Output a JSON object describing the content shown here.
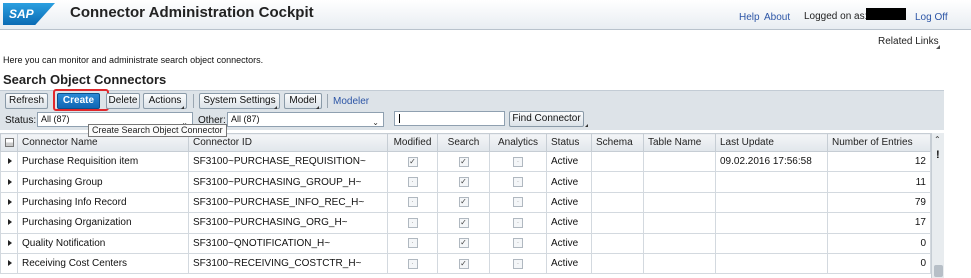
{
  "app": {
    "logo": "SAP",
    "title": "Connector Administration Cockpit"
  },
  "header_links": {
    "help": "Help",
    "about": "About",
    "logged_on": "Logged on as:",
    "log_off": "Log Off"
  },
  "related_links": "Related Links",
  "intro": "Here you can monitor and administrate search object connectors.",
  "section_title": "Search Object Connectors",
  "toolbar": {
    "refresh": "Refresh",
    "create": "Create",
    "delete": "Delete",
    "actions": "Actions",
    "system_settings": "System Settings",
    "model": "Model",
    "modeler": "Modeler"
  },
  "filters": {
    "status_label": "Status:",
    "status_value": "All (87)",
    "other_label": "Other:",
    "other_value": "All (87)",
    "search_value": "",
    "find_button": "Find Connector"
  },
  "tooltip": "Create Search Object Connector",
  "columns": [
    "Connector Name",
    "Connector ID",
    "Modified",
    "Search",
    "Analytics",
    "Status",
    "Schema",
    "Table Name",
    "Last Update",
    "Number of Entries"
  ],
  "rows": [
    {
      "name": "Purchase Requisition item",
      "id": "SF3100~PURCHASE_REQUISITION~",
      "modified": true,
      "search": true,
      "analytics": false,
      "status": "Active",
      "schema": "",
      "table": "",
      "last_update": "09.02.2016 17:56:58",
      "entries": "12"
    },
    {
      "name": "Purchasing Group",
      "id": "SF3100~PURCHASING_GROUP_H~",
      "modified": false,
      "search": true,
      "analytics": false,
      "status": "Active",
      "schema": "",
      "table": "",
      "last_update": "",
      "entries": "11"
    },
    {
      "name": "Purchasing Info Record",
      "id": "SF3100~PURCHASE_INFO_REC_H~",
      "modified": false,
      "search": true,
      "analytics": false,
      "status": "Active",
      "schema": "",
      "table": "",
      "last_update": "",
      "entries": "79"
    },
    {
      "name": "Purchasing Organization",
      "id": "SF3100~PURCHASING_ORG_H~",
      "modified": false,
      "search": true,
      "analytics": false,
      "status": "Active",
      "schema": "",
      "table": "",
      "last_update": "",
      "entries": "17"
    },
    {
      "name": "Quality Notification",
      "id": "SF3100~QNOTIFICATION_H~",
      "modified": false,
      "search": true,
      "analytics": false,
      "status": "Active",
      "schema": "",
      "table": "",
      "last_update": "",
      "entries": "0"
    },
    {
      "name": "Receiving Cost Centers",
      "id": "SF3100~RECEIVING_COSTCTR_H~",
      "modified": false,
      "search": true,
      "analytics": false,
      "status": "Active",
      "schema": "",
      "table": "",
      "last_update": "",
      "entries": "0"
    }
  ],
  "icons": {
    "expand": "triangle-right-icon",
    "checkbox_checked": "check-icon",
    "scroll_up": "chevron-up-icon"
  },
  "colors": {
    "primary_button": "#0f66b4",
    "highlight_box": "#e0282c",
    "link": "#2c55a6"
  }
}
